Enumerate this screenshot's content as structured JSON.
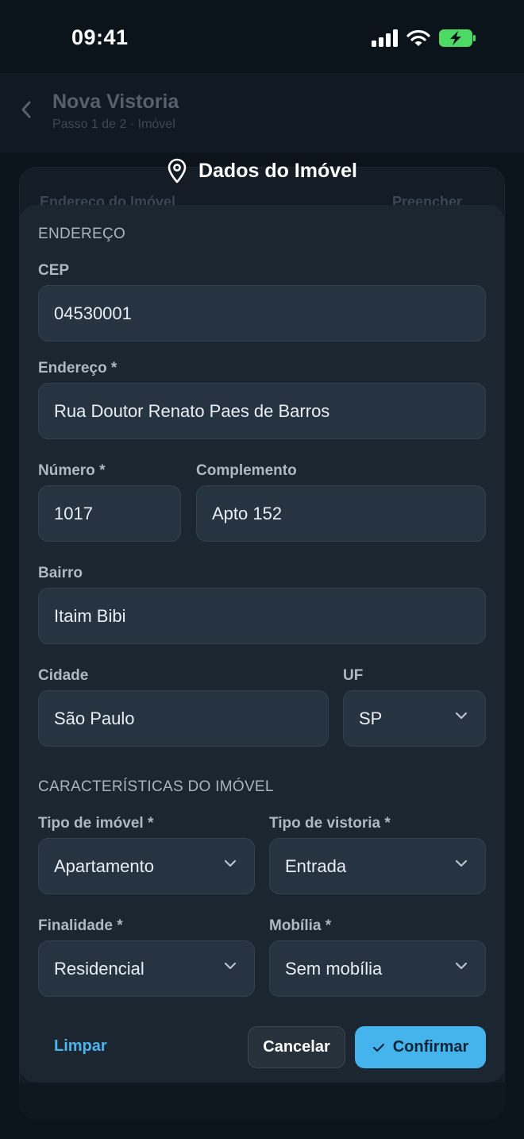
{
  "status_bar": {
    "time": "09:41"
  },
  "background": {
    "header_title": "Nova Vistoria",
    "header_subtitle": "Passo 1 de 2 · Imóvel",
    "card_peek_left": "Endereço do Imóvel",
    "card_peek_right": "Preencher"
  },
  "modal": {
    "title": "Dados do Imóvel",
    "sections": {
      "address": "ENDEREÇO",
      "features": "CARACTERÍSTICAS DO IMÓVEL"
    },
    "fields": {
      "cep": {
        "label": "CEP",
        "value": "04530001"
      },
      "endereco": {
        "label": "Endereço *",
        "value": "Rua Doutor Renato Paes de Barros"
      },
      "numero": {
        "label": "Número *",
        "value": "1017"
      },
      "complemento": {
        "label": "Complemento",
        "value": "Apto 152"
      },
      "bairro": {
        "label": "Bairro",
        "value": "Itaim Bibi"
      },
      "cidade": {
        "label": "Cidade",
        "value": "São Paulo"
      },
      "uf": {
        "label": "UF",
        "value": "SP"
      },
      "tipo_imovel": {
        "label": "Tipo de imóvel *",
        "value": "Apartamento"
      },
      "tipo_vistoria": {
        "label": "Tipo de vistoria *",
        "value": "Entrada"
      },
      "finalidade": {
        "label": "Finalidade *",
        "value": "Residencial"
      },
      "mobilia": {
        "label": "Mobília *",
        "value": "Sem mobília"
      }
    },
    "actions": {
      "clear": "Limpar",
      "cancel": "Cancelar",
      "confirm": "Confirmar"
    }
  },
  "colors": {
    "background": "#0b131b",
    "sheet": "#1b2631",
    "field": "#263340",
    "accent": "#45b3ec",
    "battery": "#4cd964"
  }
}
